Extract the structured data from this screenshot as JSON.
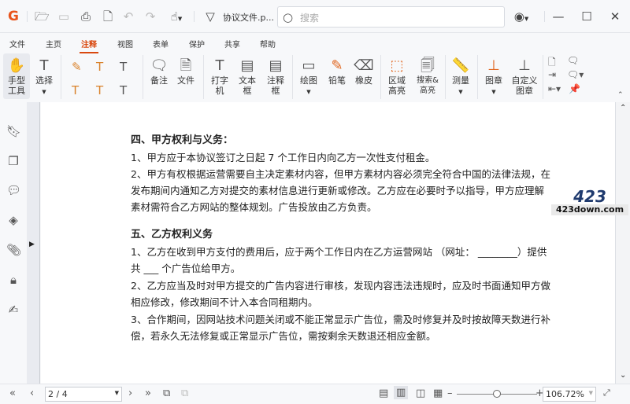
{
  "titlebar": {
    "filename": "协议文件.p...",
    "search_placeholder": "搜索"
  },
  "menu_tabs": [
    "文件",
    "主页",
    "注释",
    "视图",
    "表单",
    "保护",
    "共享",
    "帮助"
  ],
  "active_tab": "注释",
  "ribbon": {
    "hand": "手型工具",
    "select": "选择",
    "note": "备注",
    "file": "文件",
    "typewriter": "打字机",
    "textbox": "文本框",
    "callout": "注释框",
    "draw": "绘图",
    "pencil": "铅笔",
    "eraser": "橡皮",
    "area_highlight": "区域高亮",
    "search_highlight": "搜索&高亮",
    "measure": "测量",
    "stamp": "图章",
    "custom_stamp": "自定义图章"
  },
  "document": {
    "lines": [
      "四、甲方权利与义务：",
      "1、甲方应于本协议签订之日起 7 个工作日内向乙方一次性支付租金。",
      "2、甲方有权根据运营需要自主决定素材内容，但甲方素材内容必须完全符合中国的法律法规，在",
      "发布期间内通知乙方对提交的素材信息进行更新或修改。乙方应在必要时予以指导，甲方应理解",
      "素材需符合乙方网站的整体规划。广告投放由乙方负责。",
      "五、乙方权利义务",
      "1、乙方在收到甲方支付的费用后，应于两个工作日内在乙方运营网站 （网址：  ________）提供",
      "共 ___ 个广告位给甲方。",
      "2、乙方应当及时对甲方提交的广告内容进行审核，发现内容违法违规时，应及时书面通知甲方做",
      "相应修改，修改期间不计入本合同租期内。",
      "3、合作期间，因网站技术问题关闭或不能正常显示广告位，需及时修复并及时按故障天数进行补",
      "偿，若永久无法修复或正常显示广告位，需按剩余天数退还相应金额。"
    ]
  },
  "watermark": {
    "logo": "423 DOWN",
    "text": "423down.com"
  },
  "statusbar": {
    "page": "2 / 4",
    "zoom": "106.72%",
    "zoom_fraction": 0.5
  },
  "colors": {
    "accent": "#d9480f"
  }
}
